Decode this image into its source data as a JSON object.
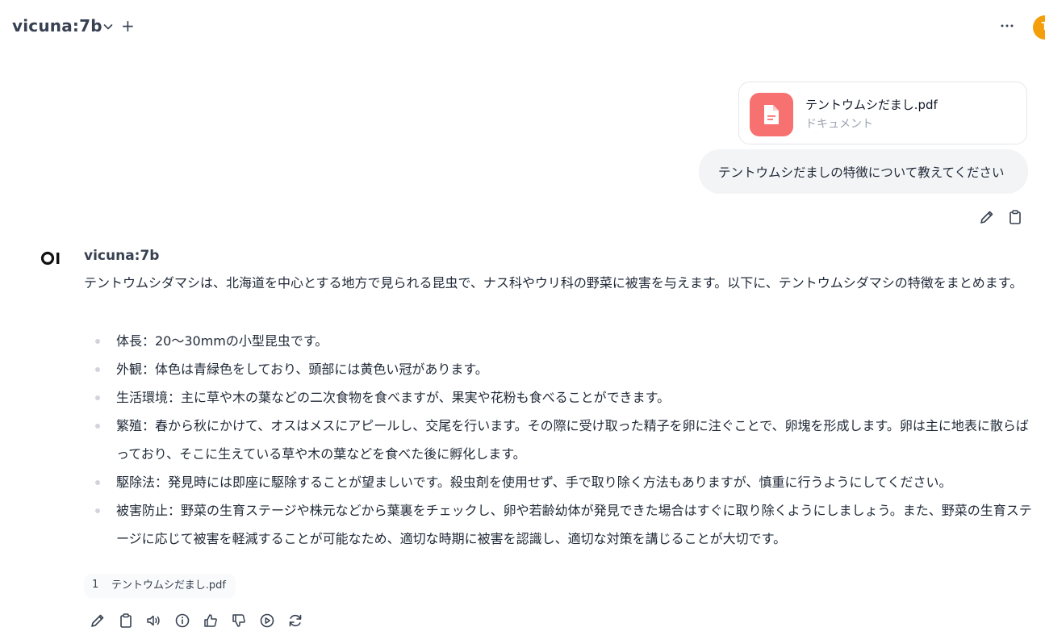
{
  "header": {
    "model_name": "vicuna:7b",
    "add_label": "+",
    "avatar_letter": "T"
  },
  "user_message": {
    "file": {
      "name": "テントウムシだまし.pdf",
      "type": "ドキュメント"
    },
    "text": "テントウムシだましの特徴について教えてください"
  },
  "assistant": {
    "name": "vicuna:7b",
    "intro": "テントウムシダマシは、北海道を中心とする地方で見られる昆虫で、ナス科やウリ科の野菜に被害を与えます。以下に、テントウムシダマシの特徴をまとめます。",
    "bullets": [
      "体長：20〜30mmの小型昆虫です。",
      "外観：体色は青緑色をしており、頭部には黄色い冠があります。",
      "生活環境：主に草や木の葉などの二次食物を食べますが、果実や花粉も食べることができます。",
      "繁殖：春から秋にかけて、オスはメスにアピールし、交尾を行います。その際に受け取った精子を卵に注ぐことで、卵塊を形成します。卵は主に地表に散らばっており、そこに生えている草や木の葉などを食べた後に孵化します。",
      "駆除法：発見時には即座に駆除することが望ましいです。殺虫剤を使用せず、手で取り除く方法もありますが、慎重に行うようにしてください。",
      "被害防止：野菜の生育ステージや株元などから葉裏をチェックし、卵や若齢幼体が発見できた場合はすぐに取り除くようにしましょう。また、野菜の生育ステージに応じて被害を軽減することが可能なため、適切な時期に被害を認識し、適切な対策を講じることが大切です。"
    ],
    "citation": {
      "number": "1",
      "name": "テントウムシだまし.pdf"
    }
  },
  "colors": {
    "file_icon_bg": "#f87171",
    "avatar_bg": "#f59e0b",
    "bubble_bg": "#f3f4f6"
  }
}
